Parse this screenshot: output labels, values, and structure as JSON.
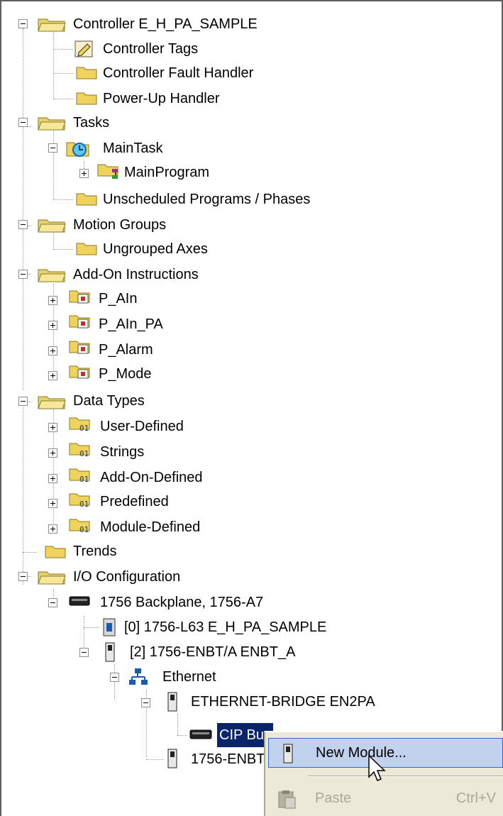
{
  "tree": {
    "items": [
      {
        "label": "Controller E_H_PA_SAMPLE",
        "icon": "folder-open-icon"
      },
      {
        "label": "Controller Tags",
        "icon": "tags-icon"
      },
      {
        "label": "Controller Fault Handler",
        "icon": "folder-icon"
      },
      {
        "label": "Power-Up Handler",
        "icon": "folder-icon"
      },
      {
        "label": "Tasks",
        "icon": "folder-open-icon"
      },
      {
        "label": "MainTask",
        "icon": "task-clock-icon"
      },
      {
        "label": "MainProgram",
        "icon": "program-icon"
      },
      {
        "label": "Unscheduled Programs / Phases",
        "icon": "folder-icon"
      },
      {
        "label": "Motion Groups",
        "icon": "folder-open-icon"
      },
      {
        "label": "Ungrouped Axes",
        "icon": "folder-icon"
      },
      {
        "label": "Add-On Instructions",
        "icon": "folder-open-icon"
      },
      {
        "label": "P_AIn",
        "icon": "aoi-icon"
      },
      {
        "label": "P_AIn_PA",
        "icon": "aoi-icon"
      },
      {
        "label": "P_Alarm",
        "icon": "aoi-icon"
      },
      {
        "label": "P_Mode",
        "icon": "aoi-icon"
      },
      {
        "label": "Data Types",
        "icon": "folder-open-icon"
      },
      {
        "label": "User-Defined",
        "icon": "datatype-icon"
      },
      {
        "label": "Strings",
        "icon": "datatype-icon"
      },
      {
        "label": "Add-On-Defined",
        "icon": "datatype-icon"
      },
      {
        "label": "Predefined",
        "icon": "datatype-icon"
      },
      {
        "label": "Module-Defined",
        "icon": "datatype-icon"
      },
      {
        "label": "Trends",
        "icon": "folder-icon"
      },
      {
        "label": "I/O Configuration",
        "icon": "folder-open-icon"
      },
      {
        "label": "1756 Backplane, 1756-A7",
        "icon": "backplane-icon"
      },
      {
        "label": "[0] 1756-L63 E_H_PA_SAMPLE",
        "icon": "controller-module-icon"
      },
      {
        "label": "[2] 1756-ENBT/A ENBT_A",
        "icon": "module-icon"
      },
      {
        "label": "Ethernet",
        "icon": "network-icon"
      },
      {
        "label": "ETHERNET-BRIDGE EN2PA",
        "icon": "module-icon"
      },
      {
        "label": "CIP Bus",
        "icon": "bus-icon"
      },
      {
        "label": "1756-ENBT",
        "icon": "module-icon"
      }
    ]
  },
  "context_menu": {
    "new_module": {
      "label": "New Module...",
      "icon": "module-icon"
    },
    "paste": {
      "label": "Paste",
      "shortcut": "Ctrl+V",
      "icon": "paste-icon"
    }
  },
  "colors": {
    "selection": "#0a246a",
    "menu_highlight": "#c1d2ee",
    "menu_bg": "#ece9d8"
  }
}
